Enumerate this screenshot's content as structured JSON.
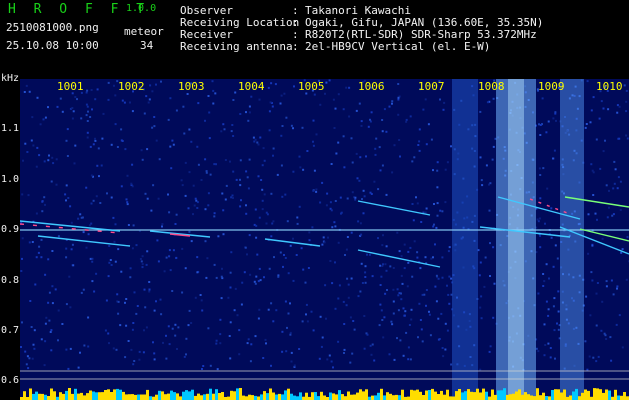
{
  "header": {
    "brand": "H R O F F T",
    "version": "1.0.0",
    "filename": "2510081000.png",
    "datetime": "25.10.08 10:00",
    "meteor_label": "meteor",
    "meteor_count": "34",
    "info_labels": [
      "Observer",
      "Receiving Location",
      "Receiver",
      "Receiving antenna"
    ],
    "info_sep": ":",
    "info_values": [
      "Takanori Kawachi",
      "Ogaki, Gifu, JAPAN (136.60E, 35.35N)",
      "R820T2(RTL-SDR) SDR-Sharp 53.372MHz",
      "2el-HB9CV Vertical (el. E-W)"
    ]
  },
  "axis": {
    "unit": "kHz",
    "y_ticks": [
      "1.1",
      "1.0",
      "0.9",
      "0.8",
      "0.7",
      "0.6"
    ],
    "x_ticks": [
      "1001",
      "1002",
      "1003",
      "1004",
      "1005",
      "1006",
      "1007",
      "1008",
      "1009",
      "1010"
    ]
  },
  "colors": {
    "background": "#000000",
    "spectrogram_base": "#000a5a",
    "echo_line": "#3fc8ff",
    "brand_green": "#19d119",
    "tick_yellow": "#ffff00",
    "level_yellow": "#ffdd00",
    "level_cyan": "#00c8ff"
  }
}
